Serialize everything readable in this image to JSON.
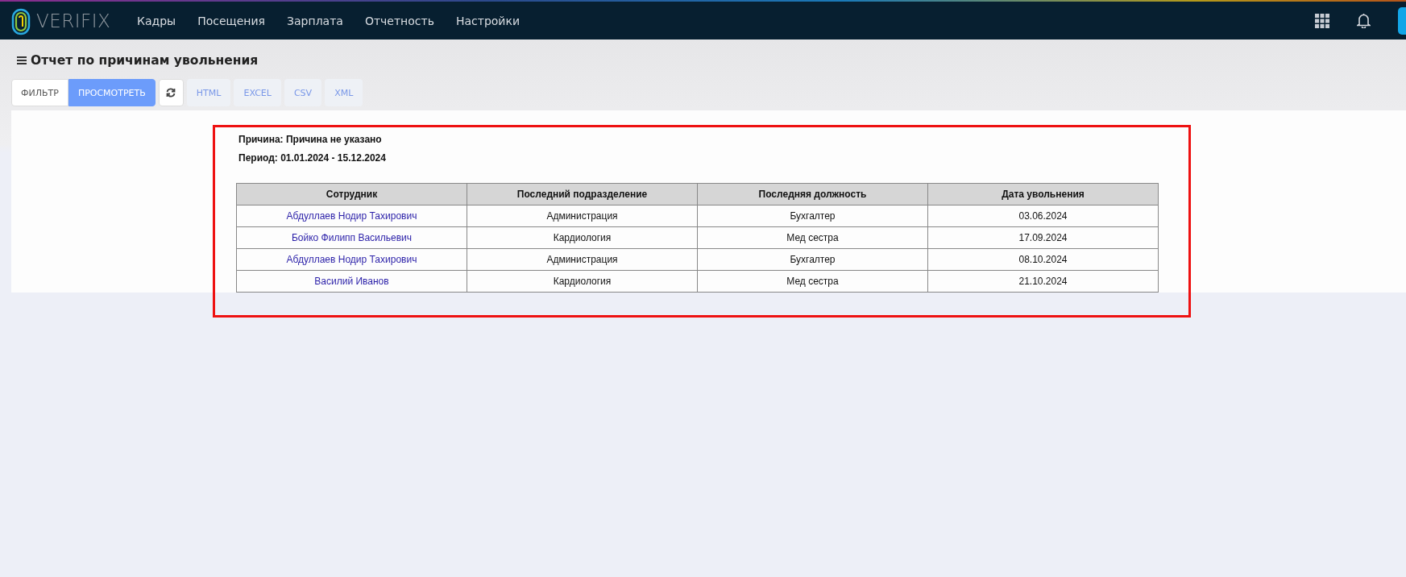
{
  "nav": {
    "logo": "VERIFIX",
    "items": [
      {
        "label": "Кадры"
      },
      {
        "label": "Посещения"
      },
      {
        "label": "Зарплата"
      },
      {
        "label": "Отчетность"
      },
      {
        "label": "Настройки"
      }
    ]
  },
  "page": {
    "title": "Отчет по причинам увольнения"
  },
  "toolbar": {
    "buttons": [
      {
        "kind": "text",
        "label": "ФИЛЬТР",
        "selected": false
      },
      {
        "kind": "text",
        "label": "ПРОСМОТРЕТЬ",
        "selected": true
      },
      {
        "kind": "refresh"
      },
      {
        "kind": "export",
        "label": "HTML"
      },
      {
        "kind": "export",
        "label": "EXCEL"
      },
      {
        "kind": "export",
        "label": "CSV"
      },
      {
        "kind": "export",
        "label": "XML"
      }
    ]
  },
  "report": {
    "reason": "Причина: Причина не указано",
    "period": "Период: 01.01.2024 - 15.12.2024",
    "table": {
      "columns": [
        "Сотрудник",
        "Последний подразделение",
        "Последняя должность",
        "Дата увольнения"
      ],
      "rows": [
        {
          "employee": "Абдуллаев Нодир Тахирович",
          "department": "Администрация",
          "position": "Бухгалтер",
          "date": "03.06.2024"
        },
        {
          "employee": "Бойко Филипп Васильевич",
          "department": "Кардиология",
          "position": "Мед сестра",
          "date": "17.09.2024"
        },
        {
          "employee": "Абдуллаев Нодир Тахирович",
          "department": "Администрация",
          "position": "Бухгалтер",
          "date": "08.10.2024"
        },
        {
          "employee": "Василий Иванов",
          "department": "Кардиология",
          "position": "Мед сестра",
          "date": "21.10.2024"
        }
      ]
    }
  }
}
